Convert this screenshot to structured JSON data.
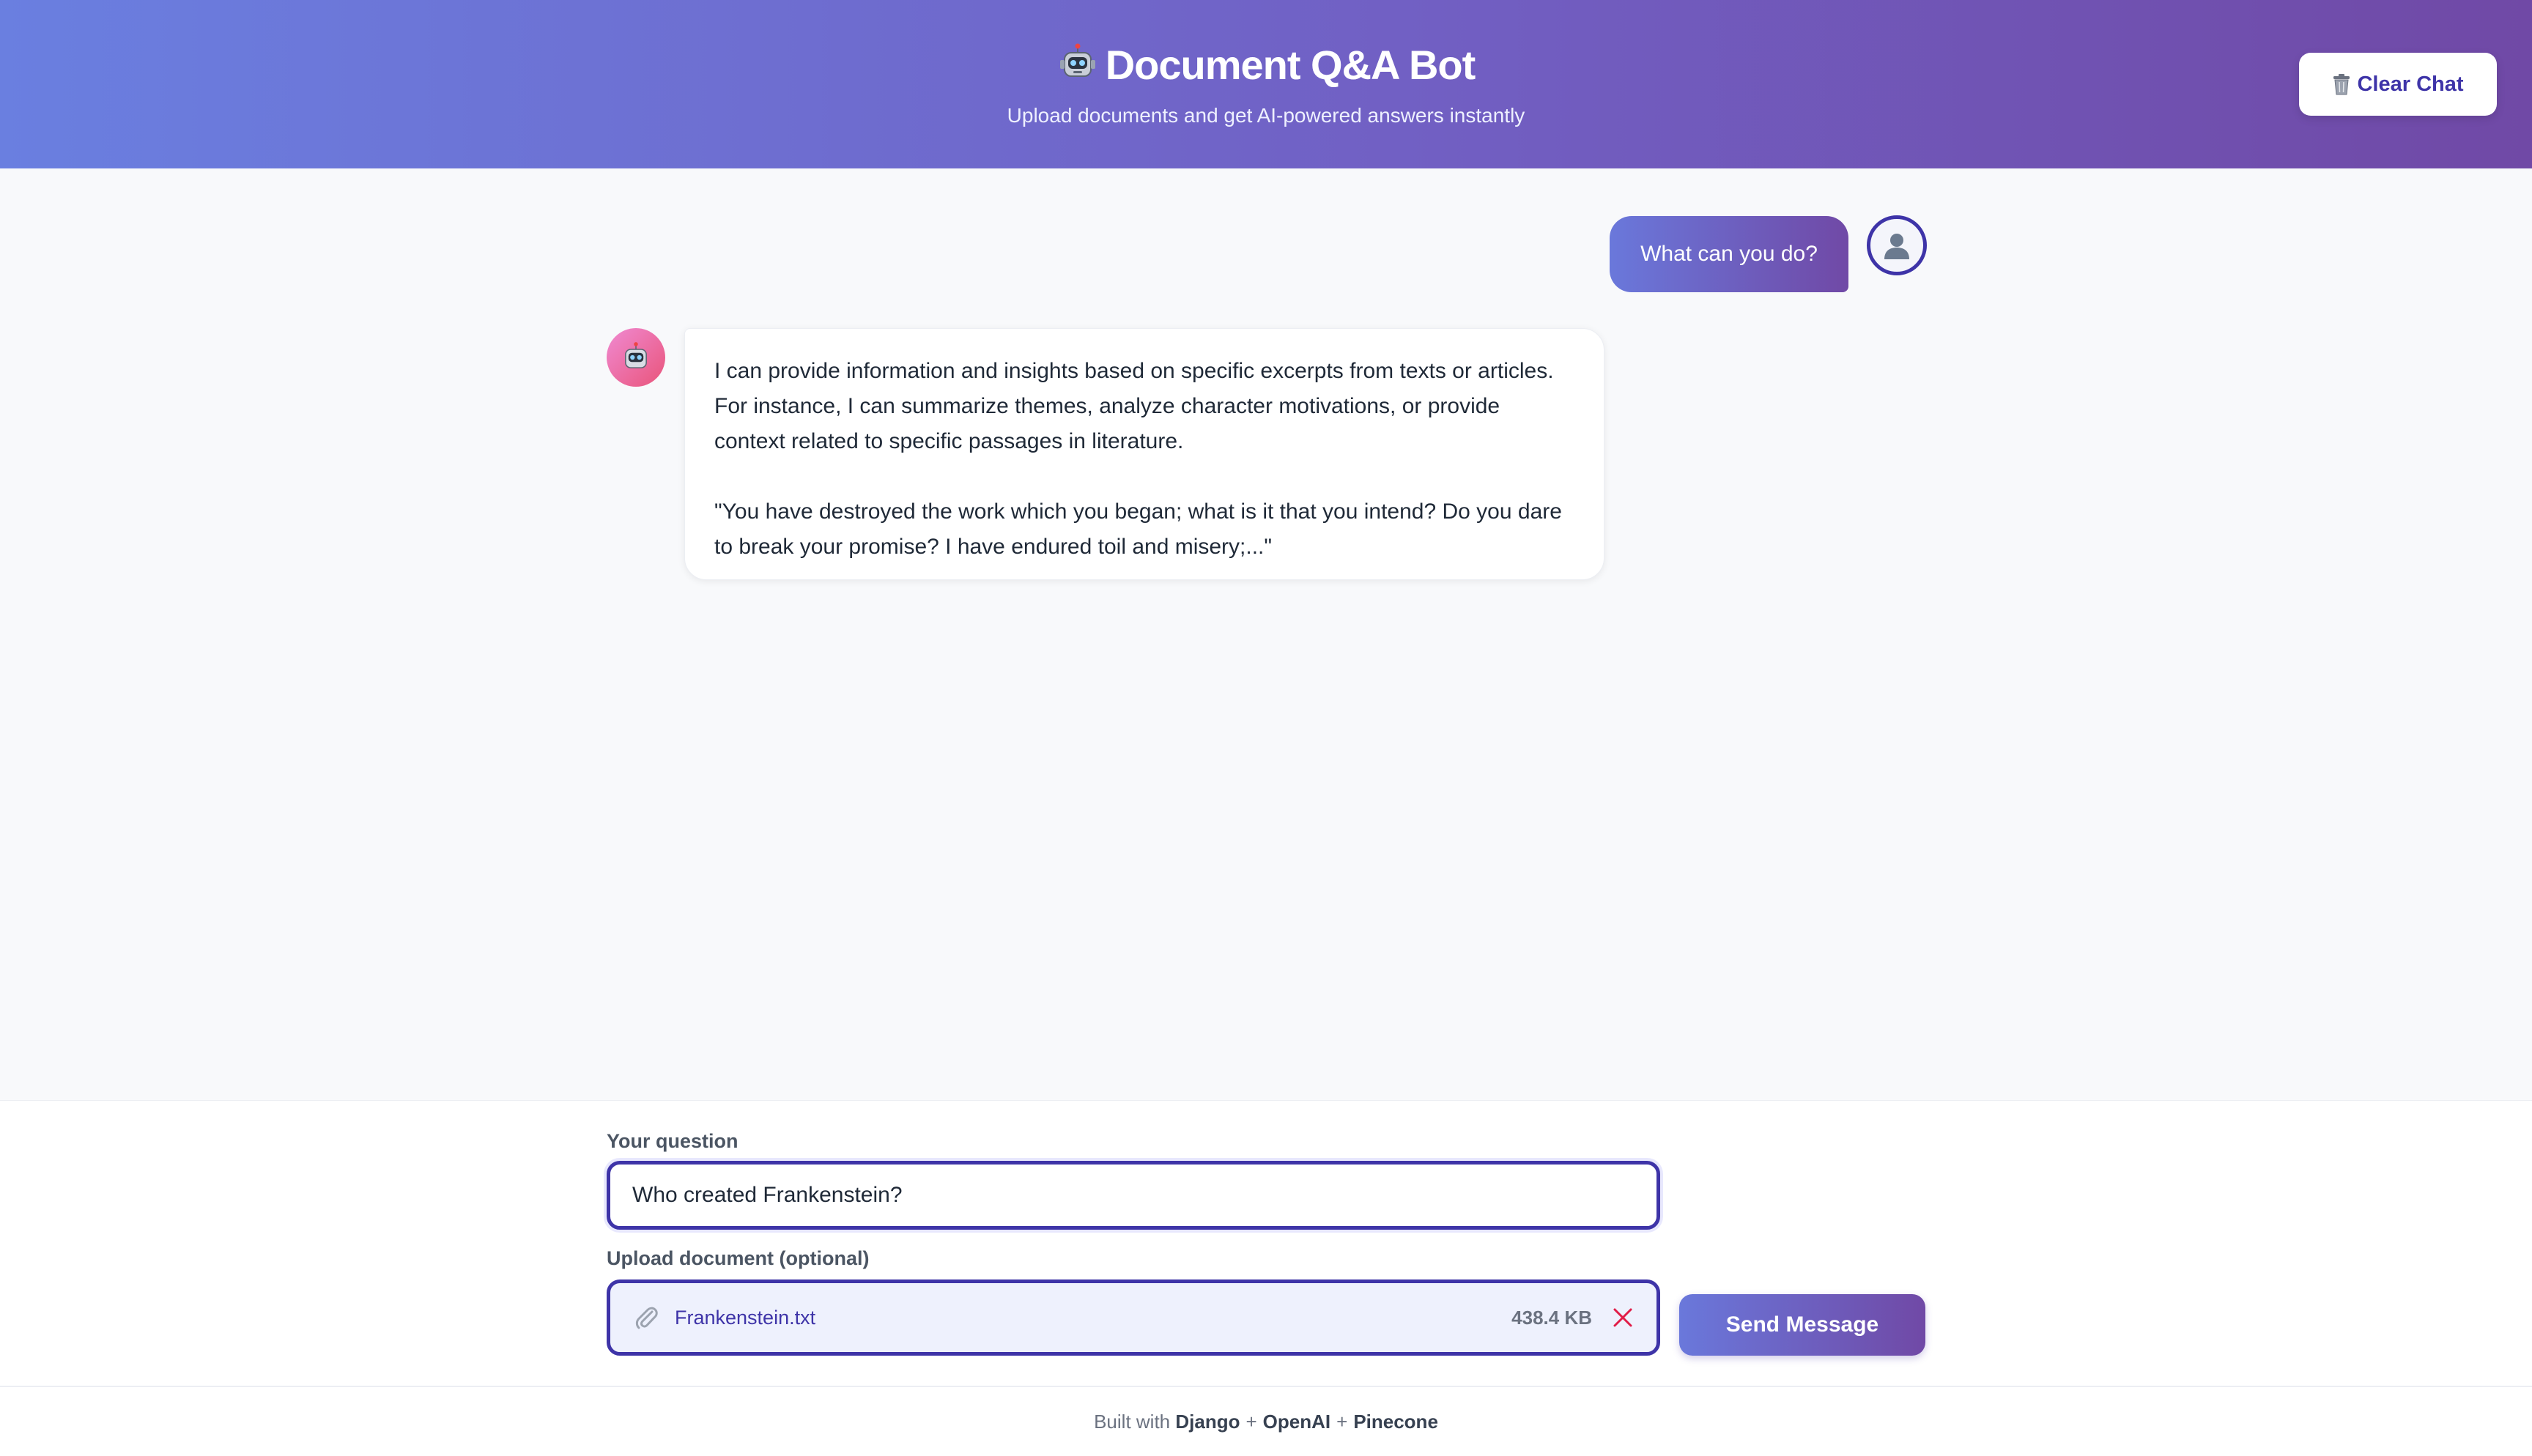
{
  "header": {
    "title": "Document Q&A Bot",
    "subtitle": "Upload documents and get AI-powered answers instantly",
    "title_icon": "robot-icon",
    "clear_button": {
      "label": "Clear Chat",
      "icon": "trash-icon"
    }
  },
  "chat": {
    "messages": [
      {
        "role": "user",
        "text": "What can you do?",
        "avatar_icon": "user-icon"
      },
      {
        "role": "bot",
        "avatar_icon": "robot-icon",
        "paragraphs": [
          "I can provide information and insights based on specific excerpts from texts or articles. For instance, I can summarize themes, analyze character motivations, or provide context related to specific passages in literature.",
          "\"You have destroyed the work which you began; what is it that you intend? Do you dare to break your promise? I have endured toil and misery;...\""
        ]
      }
    ]
  },
  "form": {
    "question_label": "Your question",
    "question_value": "Who created Frankenstein?",
    "upload_label": "Upload document (optional)",
    "upload_icon": "paperclip-icon",
    "file_name": "Frankenstein.txt",
    "file_size": "438.4 KB",
    "remove_icon": "close-icon",
    "send_label": "Send Message"
  },
  "footer": {
    "prefix": "Built with",
    "tech": [
      "Django",
      "OpenAI",
      "Pinecone"
    ],
    "separator": "+"
  },
  "colors": {
    "accent": "#3e34a8",
    "gradient_start": "#6a7fe0",
    "gradient_end": "#7049a6",
    "remove": "#e11d48"
  }
}
